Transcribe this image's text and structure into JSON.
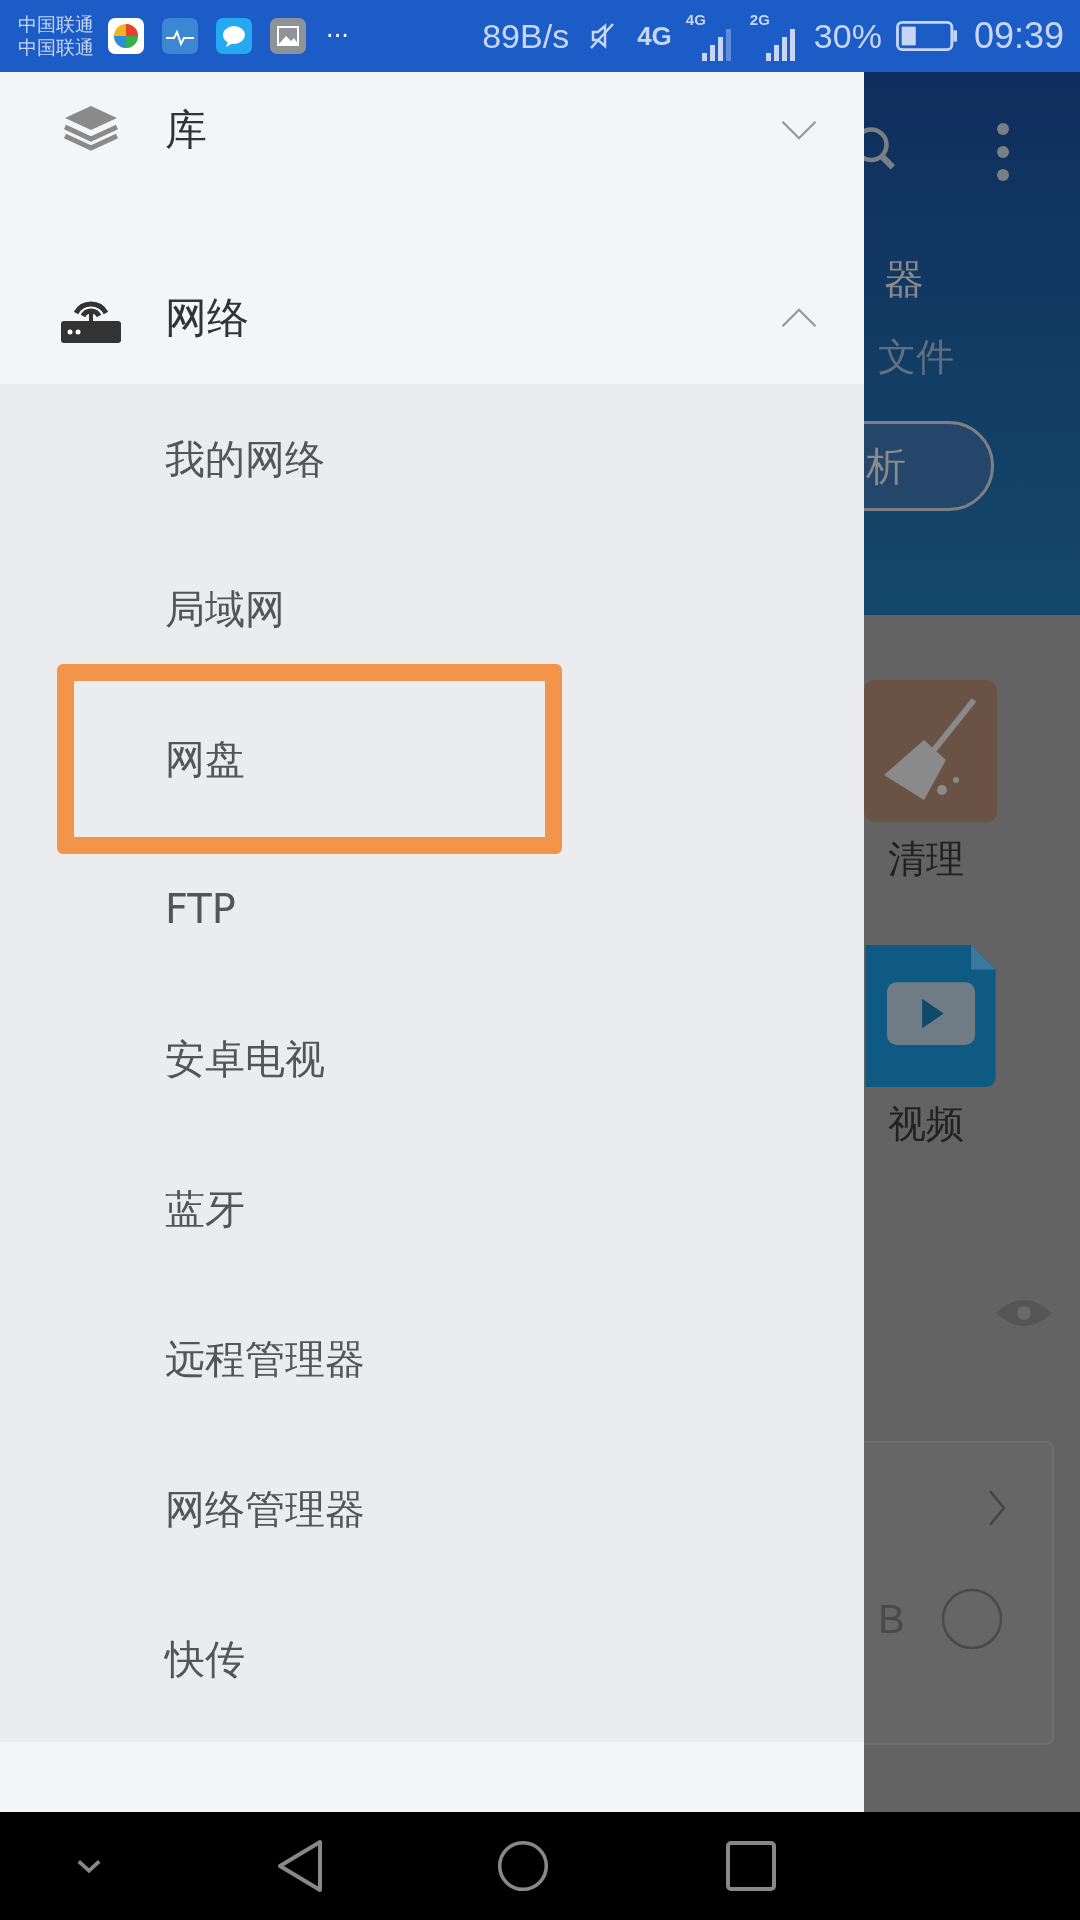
{
  "status_bar": {
    "carriers": [
      "中国联通",
      "中国联通"
    ],
    "more": "···",
    "net_speed": "89B/s",
    "network_type": "4G",
    "signals": [
      {
        "label": "4G"
      },
      {
        "label": "2G"
      }
    ],
    "battery_percent": "30%",
    "time": "09:39"
  },
  "drawer": {
    "sections": [
      {
        "label": "库",
        "kind": "library",
        "expanded": false
      },
      {
        "label": "网络",
        "kind": "network",
        "expanded": true,
        "children": [
          {
            "label": "我的网络",
            "highlighted": false
          },
          {
            "label": "局域网",
            "highlighted": false
          },
          {
            "label": "网盘",
            "highlighted": true
          },
          {
            "label": "FTP",
            "highlighted": false
          },
          {
            "label": "安卓电视",
            "highlighted": false
          },
          {
            "label": "蓝牙",
            "highlighted": false
          },
          {
            "label": "远程管理器",
            "highlighted": false
          },
          {
            "label": "网络管理器",
            "highlighted": false
          },
          {
            "label": "快传",
            "highlighted": false
          }
        ]
      }
    ]
  },
  "background_app": {
    "title_fragment": "器",
    "subtitle_fragment": "文件",
    "button_fragment": "析",
    "shortcuts": [
      {
        "label": "清理",
        "kind": "clean"
      },
      {
        "label": "视频",
        "kind": "video"
      }
    ],
    "card_fragment": "B"
  }
}
